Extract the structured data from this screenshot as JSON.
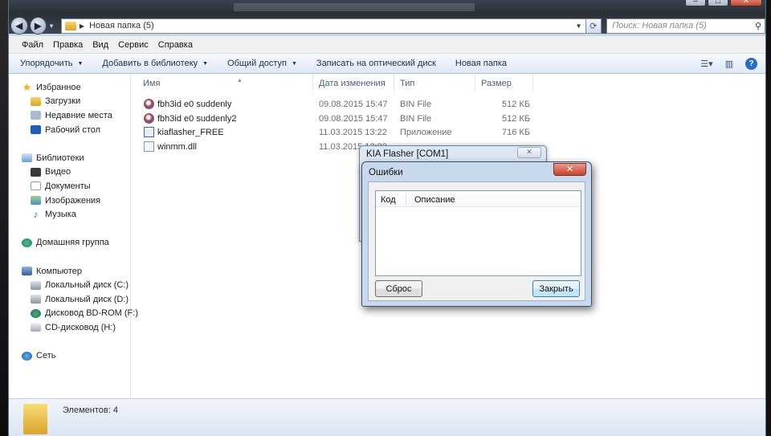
{
  "window": {
    "breadcrumb_path": "Новая папка (5)",
    "search_placeholder": "Поиск: Новая папка (5)"
  },
  "menubar": [
    "Файл",
    "Правка",
    "Вид",
    "Сервис",
    "Справка"
  ],
  "toolbar": {
    "organize": "Упорядочить",
    "add_to_library": "Добавить в библиотеку",
    "share": "Общий доступ",
    "burn": "Записать на оптический диск",
    "new_folder": "Новая папка"
  },
  "nav": {
    "favorites": "Избранное",
    "downloads": "Загрузки",
    "recent": "Недавние места",
    "desktop": "Рабочий стол",
    "libraries": "Библиотеки",
    "video": "Видео",
    "documents": "Документы",
    "images": "Изображения",
    "music": "Музыка",
    "homegroup": "Домашняя группа",
    "computer": "Компьютер",
    "disk_c": "Локальный диск (C:)",
    "disk_d": "Локальный диск (D:)",
    "disk_f": "Дисковод BD-ROM (F:)",
    "disk_h": "CD-дисковод (H:)",
    "network": "Сеть"
  },
  "columns": {
    "name": "Имя",
    "date": "Дата изменения",
    "type": "Тип",
    "size": "Размер"
  },
  "files": [
    {
      "name": "fbh3id e0 suddenly",
      "date": "09.08.2015 15:47",
      "type": "BIN File",
      "size": "512 КБ",
      "icon": "bin-file-icon"
    },
    {
      "name": "fbh3id e0 suddenly2",
      "date": "09.08.2015 15:47",
      "type": "BIN File",
      "size": "512 КБ",
      "icon": "bin-file-icon"
    },
    {
      "name": "kiaflasher_FREE",
      "date": "11.03.2015 13:22",
      "type": "Приложение",
      "size": "716 КБ",
      "icon": "application-icon"
    },
    {
      "name": "winmm.dll",
      "date": "11.03.2015 13:22",
      "type": "",
      "size": "",
      "icon": "dll-file-icon"
    }
  ],
  "status": {
    "items_count": "Элементов: 4"
  },
  "kia_window": {
    "title": "KIA Flasher [COM1]"
  },
  "errors_dialog": {
    "title": "Ошибки",
    "col_code": "Код",
    "col_description": "Описание",
    "reset_button": "Сброс",
    "close_button": "Закрыть"
  }
}
